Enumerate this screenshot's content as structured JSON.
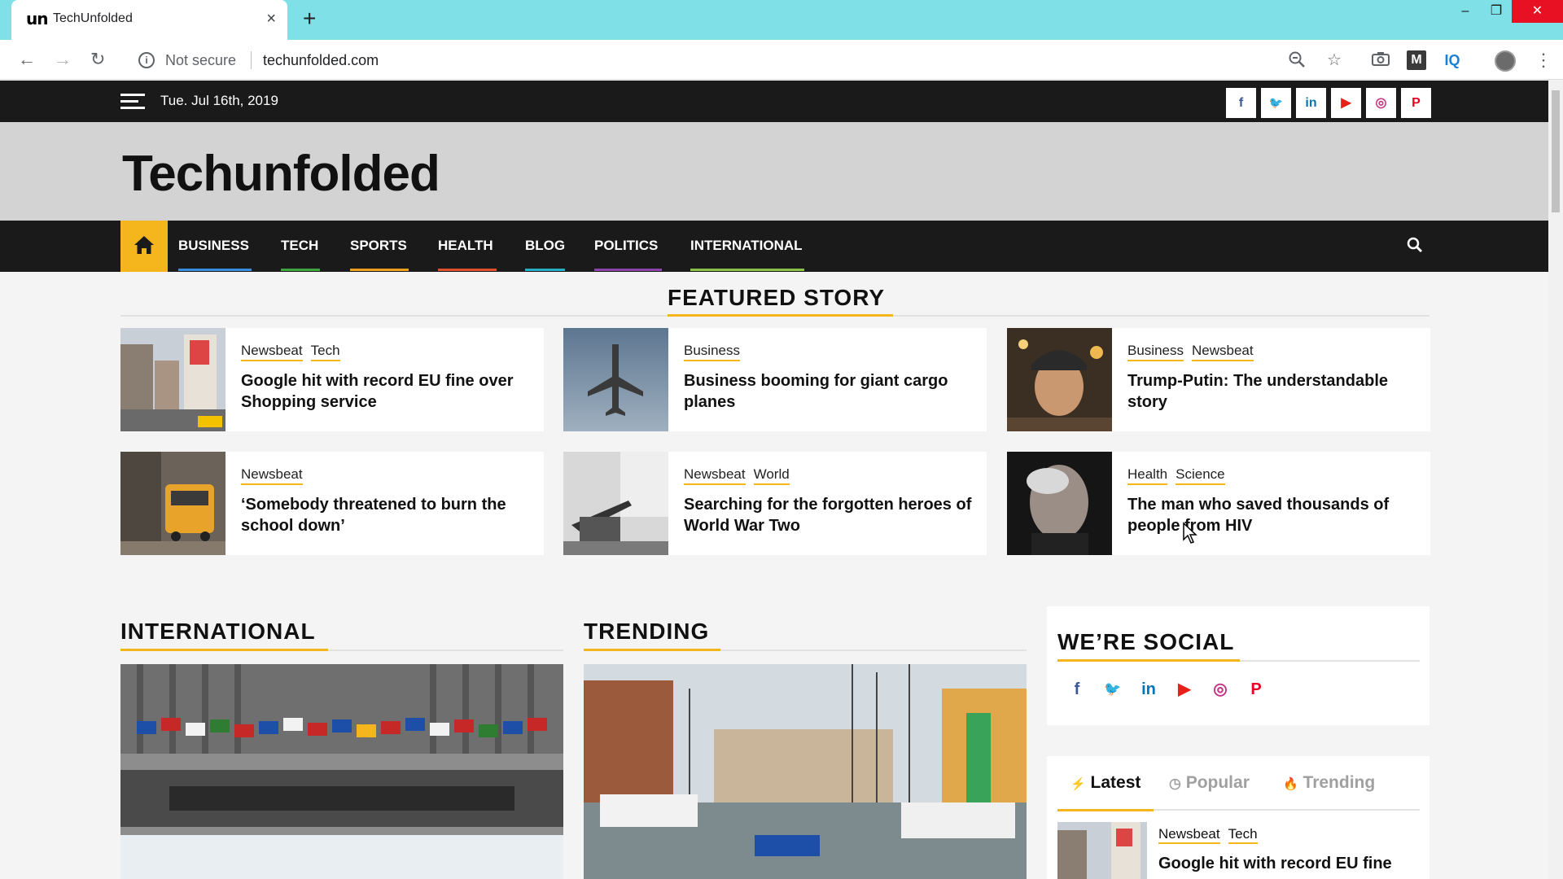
{
  "browser": {
    "tab_icon_text": "un",
    "tab_title": "TechUnfolded",
    "tab_close": "×",
    "new_tab": "+",
    "security_label": "Not secure",
    "url": "techunfolded.com",
    "minimize": "–",
    "maximize": "❐",
    "close": "✕",
    "ext_m": "M",
    "ext_iq": "IQ"
  },
  "topbar": {
    "date": "Tue. Jul 16th, 2019",
    "social": [
      {
        "name": "facebook",
        "glyph": "f",
        "color": "#3b5998"
      },
      {
        "name": "twitter",
        "glyph": "🐦",
        "color": "#1da1f2"
      },
      {
        "name": "linkedin",
        "glyph": "in",
        "color": "#0077b5"
      },
      {
        "name": "youtube",
        "glyph": "▶",
        "color": "#e62117"
      },
      {
        "name": "instagram",
        "glyph": "◎",
        "color": "#c13584"
      },
      {
        "name": "pinterest",
        "glyph": "P",
        "color": "#e60023"
      }
    ]
  },
  "site": {
    "logo": "Techunfolded",
    "accent_color": "#f5b51c"
  },
  "nav": {
    "items": [
      {
        "label": "BUSINESS",
        "color": "#3b8fe0"
      },
      {
        "label": "TECH",
        "color": "#3ea83e"
      },
      {
        "label": "SPORTS",
        "color": "#f0a020"
      },
      {
        "label": "HEALTH",
        "color": "#e0502a"
      },
      {
        "label": "BLOG",
        "color": "#26b0c8"
      },
      {
        "label": "POLITICS",
        "color": "#8e44ad"
      },
      {
        "label": "INTERNATIONAL",
        "color": "#8bc34a"
      }
    ]
  },
  "featured": {
    "heading": "FEATURED STORY",
    "cards": [
      {
        "cats": [
          "Newsbeat",
          "Tech"
        ],
        "title": "Google hit with record EU fine over Shopping service"
      },
      {
        "cats": [
          "Business"
        ],
        "title": "Business booming for giant cargo planes"
      },
      {
        "cats": [
          "Business",
          "Newsbeat"
        ],
        "title": "Trump-Putin: The understandable story"
      },
      {
        "cats": [
          "Newsbeat"
        ],
        "title": "‘Somebody threatened to burn the school down’"
      },
      {
        "cats": [
          "Newsbeat",
          "World"
        ],
        "title": "Searching for the forgotten heroes of World War Two"
      },
      {
        "cats": [
          "Health",
          "Science"
        ],
        "title": "The man who saved thousands of people from HIV"
      }
    ]
  },
  "sections": {
    "international": "INTERNATIONAL",
    "trending": "TRENDING"
  },
  "social_widget": {
    "heading": "WE’RE SOCIAL"
  },
  "tabs_widget": {
    "tabs": [
      {
        "label": "Latest",
        "icon": "⚡"
      },
      {
        "label": "Popular",
        "icon": "◷"
      },
      {
        "label": "Trending",
        "icon": "🔥"
      }
    ],
    "latest": {
      "cats": [
        "Newsbeat",
        "Tech"
      ],
      "title": "Google hit with record EU fine"
    }
  }
}
